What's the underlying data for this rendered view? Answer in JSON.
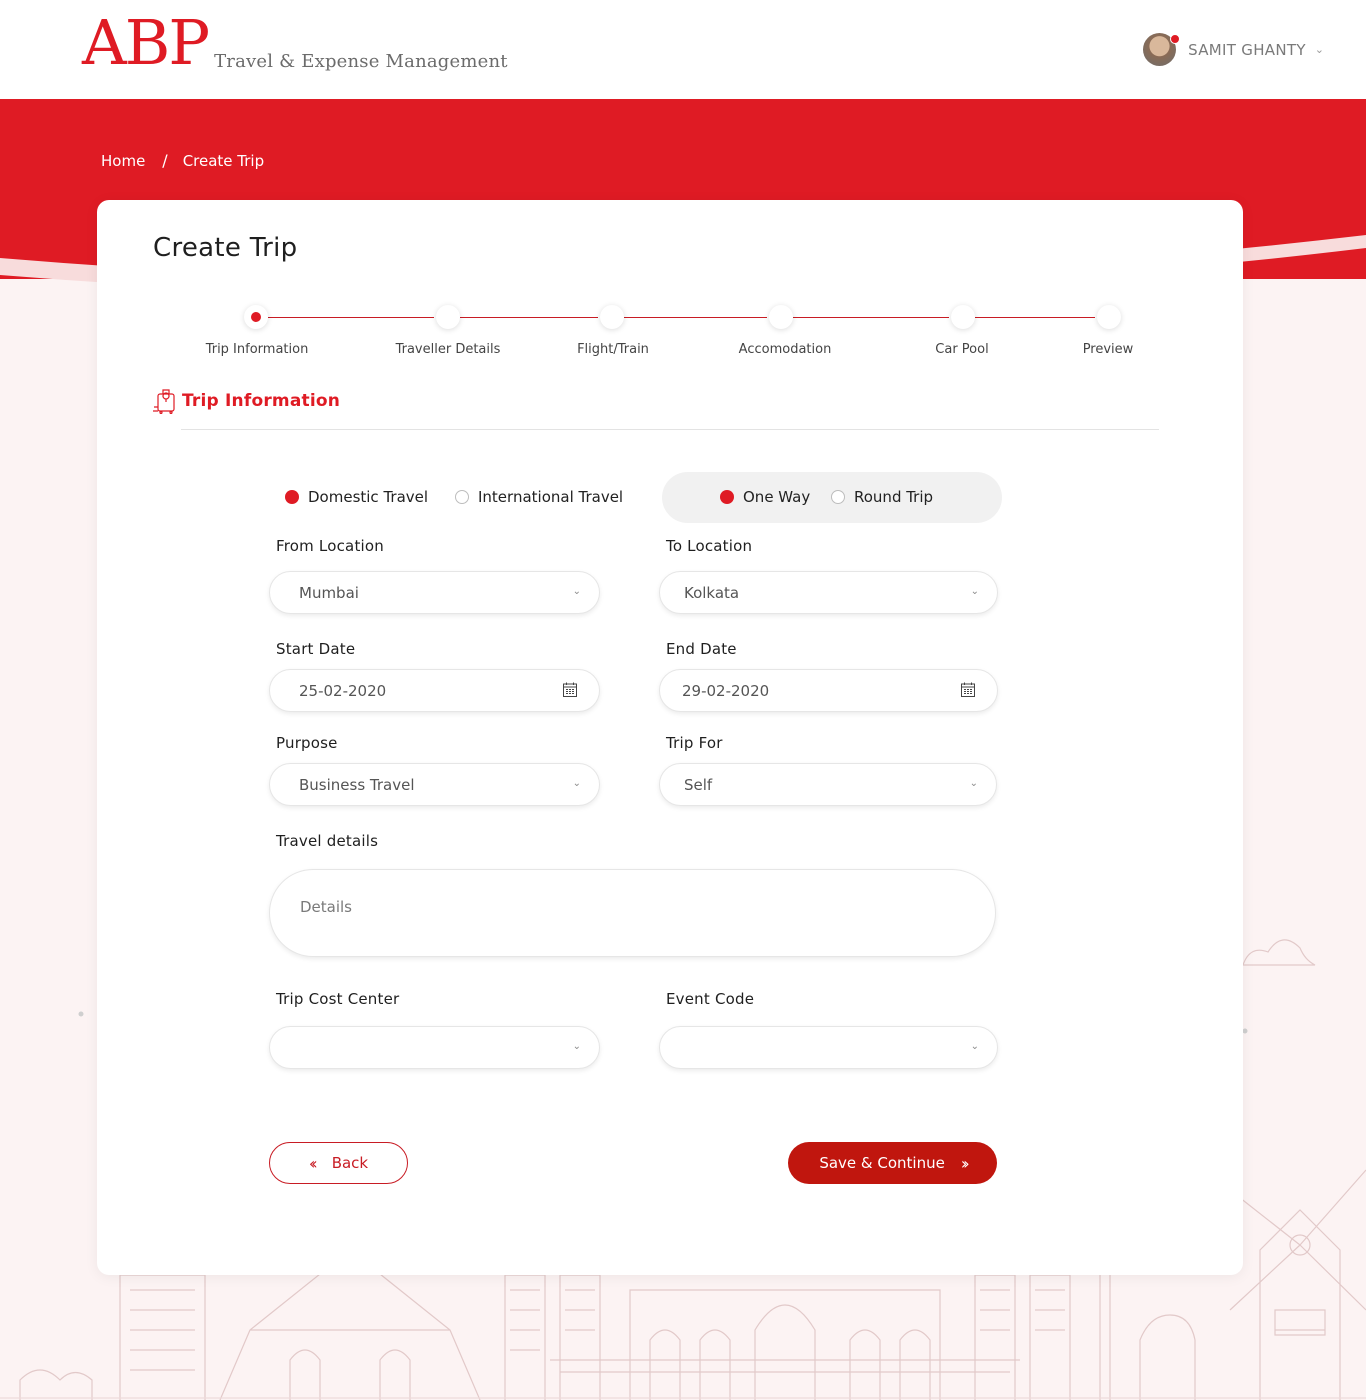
{
  "header": {
    "logo_mark": "ABP",
    "logo_sub": "Travel & Expense Management",
    "user_name": "SAMIT GHANTY"
  },
  "breadcrumb": {
    "home": "Home",
    "separator": "/",
    "current": "Create Trip"
  },
  "page": {
    "title": "Create Trip"
  },
  "stepper": {
    "steps": [
      {
        "label": "Trip Information",
        "active": true
      },
      {
        "label": "Traveller Details",
        "active": false
      },
      {
        "label": "Flight/Train",
        "active": false
      },
      {
        "label": "Accomodation",
        "active": false
      },
      {
        "label": "Car Pool",
        "active": false
      },
      {
        "label": "Preview",
        "active": false
      }
    ]
  },
  "section": {
    "title": "Trip Information",
    "icon": "luggage-icon"
  },
  "travel_scope": {
    "options": [
      "Domestic Travel",
      "International Travel"
    ],
    "selected": "Domestic Travel"
  },
  "trip_type": {
    "options": [
      "One Way",
      "Round Trip"
    ],
    "selected": "One Way"
  },
  "form": {
    "from_location": {
      "label": "From Location",
      "value": "Mumbai"
    },
    "to_location": {
      "label": "To Location",
      "value": "Kolkata"
    },
    "start_date": {
      "label": "Start Date",
      "value": "25-02-2020"
    },
    "end_date": {
      "label": "End Date",
      "value": "29-02-2020"
    },
    "purpose": {
      "label": "Purpose",
      "value": "Business Travel"
    },
    "trip_for": {
      "label": "Trip For",
      "value": "Self"
    },
    "travel_details": {
      "label": "Travel details",
      "placeholder": "Details"
    },
    "trip_cost_center": {
      "label": "Trip Cost Center",
      "value": ""
    },
    "event_code": {
      "label": "Event Code",
      "value": ""
    }
  },
  "actions": {
    "back_label": "Back",
    "save_label": "Save & Continue"
  },
  "colors": {
    "brand_red": "#df1b24",
    "button_red": "#c0160e",
    "background": "#fcf3f3"
  }
}
